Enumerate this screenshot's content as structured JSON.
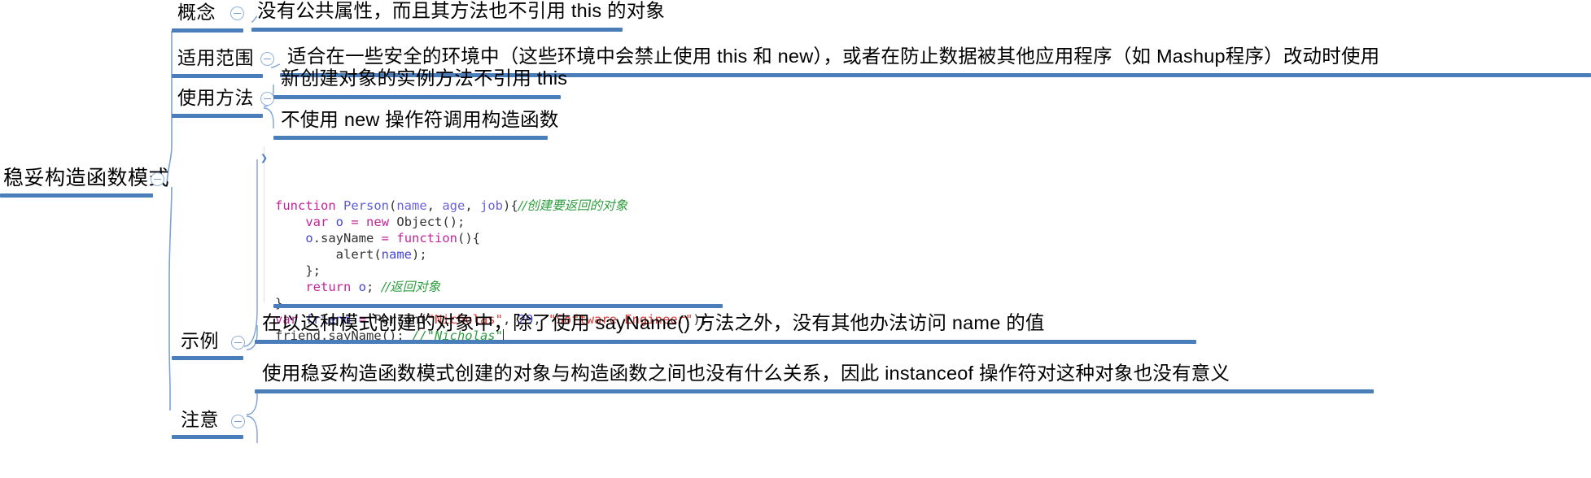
{
  "map": {
    "root": {
      "label": "稳妥构造函数模式",
      "toggle_icon": "collapse-circle-minus-icon"
    },
    "branches": [
      {
        "key": "concept",
        "label": "概念",
        "toggle_icon": "collapse-circle-minus-icon",
        "children": [
          {
            "label": "没有公共属性，而且其方法也不引用 this 的对象"
          }
        ]
      },
      {
        "key": "scope",
        "label": "适用范围",
        "toggle_icon": "collapse-circle-minus-icon",
        "children": [
          {
            "label": "适合在一些安全的环境中（这些环境中会禁止使用 this 和 new），或者在防止数据被其他应用程序（如 Mashup程序）改动时使用"
          }
        ]
      },
      {
        "key": "usage",
        "label": "使用方法",
        "toggle_icon": "collapse-circle-minus-icon",
        "children": [
          {
            "label": "新创建对象的实例方法不引用 this"
          },
          {
            "label": "不使用 new 操作符调用构造函数"
          }
        ]
      },
      {
        "key": "example",
        "label": "示例",
        "toggle_icon": "collapse-circle-minus-icon",
        "children": []
      },
      {
        "key": "notice",
        "label": "注意",
        "toggle_icon": "collapse-circle-minus-icon",
        "children": [
          {
            "label": "在以这种模式创建的对象中，除了使用 sayName() 方法之外，没有其他办法访问 name 的值"
          },
          {
            "label": "使用稳妥构造函数模式创建的对象与构造函数之间也没有什么关系，因此 instanceof 操作符对这种对象也没有意义"
          }
        ]
      }
    ]
  },
  "code": {
    "prompt_icon": "chevron-right-icon",
    "lines": [
      {
        "id": "l1",
        "tokens": [
          {
            "t": "function ",
            "c": "kw"
          },
          {
            "t": "Person",
            "c": "fn"
          },
          {
            "t": "(",
            "c": "plain"
          },
          {
            "t": "name",
            "c": "param"
          },
          {
            "t": ", ",
            "c": "plain"
          },
          {
            "t": "age",
            "c": "param"
          },
          {
            "t": ", ",
            "c": "plain"
          },
          {
            "t": "job",
            "c": "param"
          },
          {
            "t": "){",
            "c": "plain"
          },
          {
            "t": "//创建要返回的对象",
            "c": "cmt-zh"
          }
        ]
      },
      {
        "id": "l2",
        "tokens": [
          {
            "t": "    ",
            "c": "plain"
          },
          {
            "t": "var",
            "c": "kw"
          },
          {
            "t": " ",
            "c": "plain"
          },
          {
            "t": "o",
            "c": "var"
          },
          {
            "t": " ",
            "c": "plain"
          },
          {
            "t": "=",
            "c": "kw"
          },
          {
            "t": " ",
            "c": "plain"
          },
          {
            "t": "new",
            "c": "kw"
          },
          {
            "t": " Object();",
            "c": "plain"
          }
        ]
      },
      {
        "id": "l3",
        "tokens": [
          {
            "t": "    ",
            "c": "plain"
          },
          {
            "t": "o",
            "c": "var"
          },
          {
            "t": ".sayName ",
            "c": "plain"
          },
          {
            "t": "=",
            "c": "kw"
          },
          {
            "t": " ",
            "c": "plain"
          },
          {
            "t": "function",
            "c": "kw"
          },
          {
            "t": "(){",
            "c": "plain"
          }
        ]
      },
      {
        "id": "l4",
        "tokens": [
          {
            "t": "        alert(",
            "c": "plain"
          },
          {
            "t": "name",
            "c": "var"
          },
          {
            "t": ");",
            "c": "plain"
          }
        ]
      },
      {
        "id": "l5",
        "tokens": [
          {
            "t": "    };",
            "c": "plain"
          }
        ]
      },
      {
        "id": "l6",
        "tokens": [
          {
            "t": "    ",
            "c": "plain"
          },
          {
            "t": "return",
            "c": "kw"
          },
          {
            "t": " ",
            "c": "plain"
          },
          {
            "t": "o",
            "c": "var"
          },
          {
            "t": "; ",
            "c": "plain"
          },
          {
            "t": "//返回对象",
            "c": "cmt-zh"
          }
        ]
      },
      {
        "id": "l7",
        "tokens": [
          {
            "t": "}",
            "c": "plain"
          }
        ]
      },
      {
        "id": "l8",
        "tokens": [
          {
            "t": "var",
            "c": "kw"
          },
          {
            "t": " ",
            "c": "plain"
          },
          {
            "t": "friend",
            "c": "var"
          },
          {
            "t": " ",
            "c": "plain"
          },
          {
            "t": "=",
            "c": "kw"
          },
          {
            "t": " Person(",
            "c": "plain"
          },
          {
            "t": "\"Nicholas\"",
            "c": "str"
          },
          {
            "t": ", ",
            "c": "plain"
          },
          {
            "t": "29",
            "c": "num"
          },
          {
            "t": ", ",
            "c": "plain"
          },
          {
            "t": "\"Software Engineer\"",
            "c": "str"
          },
          {
            "t": ");",
            "c": "plain"
          }
        ]
      },
      {
        "id": "l9",
        "tokens": [
          {
            "t": "friend.sayName(); ",
            "c": "plain"
          },
          {
            "t": "//\"Nicholas\"",
            "c": "cmt"
          }
        ]
      }
    ]
  },
  "colors": {
    "bar": "#4a7ebb",
    "bar_light": "#7ba0d0",
    "link": "#7ba3d4",
    "toggle_border": "#8fb0dc",
    "text": "#000000",
    "code_default": "#333333",
    "code_keyword": "#c2259a",
    "code_function": "#5d5dd6",
    "code_variable": "#4646d6",
    "code_string": "#d93a36",
    "code_number": "#3a3ad6",
    "code_comment": "#2f9e3f"
  }
}
